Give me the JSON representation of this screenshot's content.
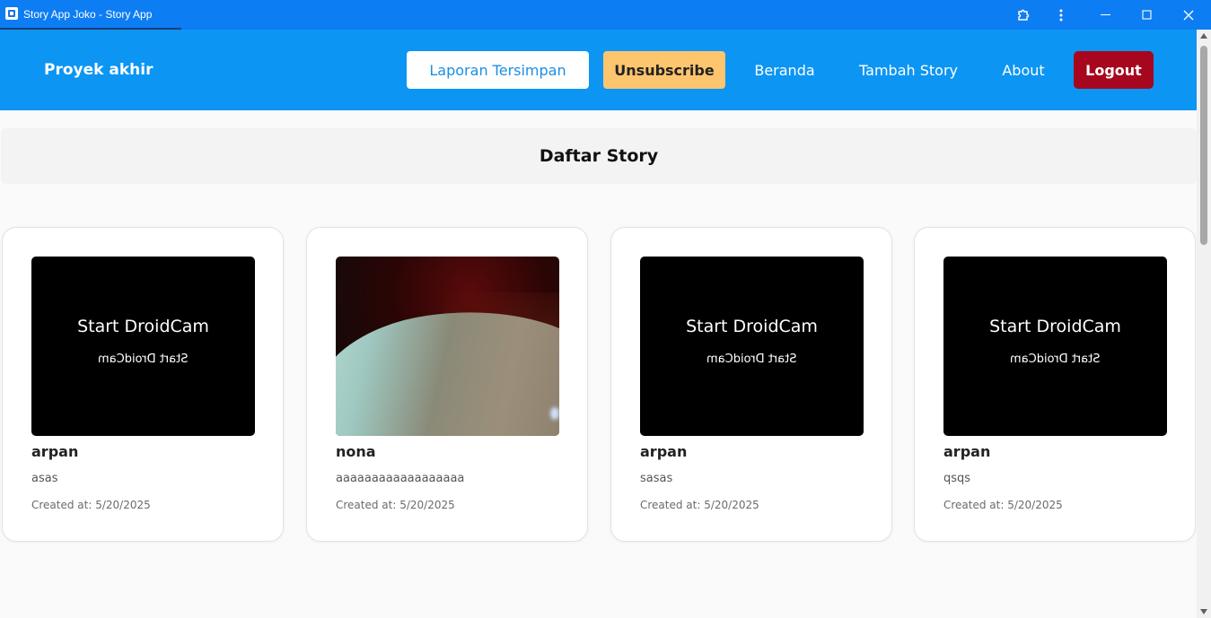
{
  "window": {
    "title": "Story App Joko - Story App"
  },
  "header": {
    "brand": "Proyek akhir",
    "saved_reports": "Laporan Tersimpan",
    "unsubscribe": "Unsubscribe",
    "home": "Beranda",
    "add_story": "Tambah Story",
    "about": "About",
    "logout": "Logout"
  },
  "main": {
    "title": "Daftar Story",
    "stories": [
      {
        "name": "arpan",
        "description": "asas",
        "created": "Created at: 5/20/2025",
        "placeholder_line1": "Start DroidCam",
        "placeholder_line2": "Start DroidCam"
      },
      {
        "name": "nona",
        "description": "aaaaaaaaaaaaaaaaaa",
        "created": "Created at: 5/20/2025"
      },
      {
        "name": "arpan",
        "description": "sasas",
        "created": "Created at: 5/20/2025",
        "placeholder_line1": "Start DroidCam",
        "placeholder_line2": "Start DroidCam"
      },
      {
        "name": "arpan",
        "description": "qsqs",
        "created": "Created at: 5/20/2025",
        "placeholder_line1": "Start DroidCam",
        "placeholder_line2": "Start DroidCam"
      }
    ]
  },
  "colors": {
    "titlebar": "#0d7df4",
    "header": "#0c95f3",
    "unsubscribe": "#fdc56d",
    "logout": "#a6071f",
    "saved_text": "#1a8fe3"
  },
  "icons": {
    "app": "app-icon",
    "extensions": "puzzle-icon",
    "menu": "more-vertical-icon",
    "minimize": "minimize-icon",
    "maximize": "maximize-icon",
    "close": "close-icon"
  }
}
